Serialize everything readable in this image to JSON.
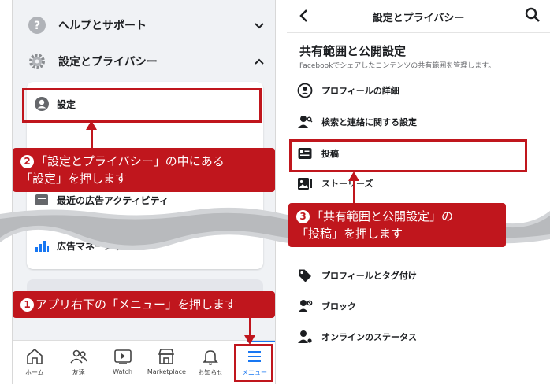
{
  "left": {
    "help_label": "ヘルプとサポート",
    "settings_privacy_label": "設定とプライバシー",
    "settings_label": "設定",
    "partial_item_label": "最近の広告アクティビティ",
    "ads_manager_label": "広告マネージャ",
    "bottom_nav": [
      {
        "label": "ホーム",
        "icon": "home-icon"
      },
      {
        "label": "友達",
        "icon": "friends-icon"
      },
      {
        "label": "Watch",
        "icon": "watch-icon"
      },
      {
        "label": "Marketplace",
        "icon": "marketplace-icon"
      },
      {
        "label": "お知らせ",
        "icon": "bell-icon"
      },
      {
        "label": "メニュー",
        "icon": "menu-icon"
      }
    ]
  },
  "right": {
    "header_title": "設定とプライバシー",
    "section_title": "共有範囲と公開設定",
    "section_desc": "Facebookでシェアしたコンテンツの共有範囲を管理します。",
    "items": [
      {
        "label": "プロフィールの詳細",
        "icon": "profile-icon"
      },
      {
        "label": "検索と連絡に関する設定",
        "icon": "person-search-icon"
      },
      {
        "label": "投稿",
        "icon": "post-icon"
      },
      {
        "label": "ストーリーズ",
        "icon": "stories-icon"
      },
      {
        "label": "プロフィールとタグ付け",
        "icon": "tag-icon"
      },
      {
        "label": "ブロック",
        "icon": "block-icon"
      },
      {
        "label": "オンラインのステータス",
        "icon": "online-status-icon"
      }
    ]
  },
  "callouts": {
    "c1_num": "1",
    "c1_text": "アプリ右下の「メニュー」を押します",
    "c2_num": "2",
    "c2_line1": "「設定とプライバシー」の中にある",
    "c2_line2": "「設定」を押します",
    "c3_num": "3",
    "c3_line1": "「共有範囲と公開設定」の",
    "c3_line2": "「投稿」を押します"
  },
  "colors": {
    "accent_red": "#c0161d",
    "facebook_blue": "#1877f2"
  }
}
